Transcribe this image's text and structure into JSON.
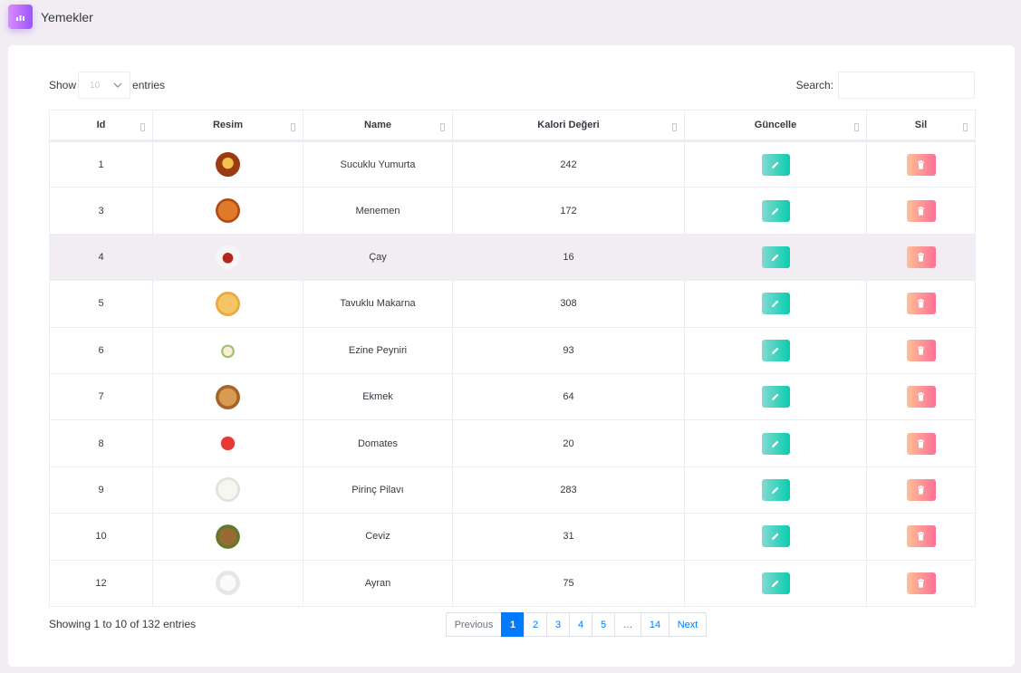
{
  "header": {
    "title": "Yemekler",
    "icon": "chart-icon"
  },
  "length": {
    "show_label": "Show",
    "value": "10",
    "entries_label": "entries"
  },
  "search": {
    "label": "Search:",
    "value": ""
  },
  "columns": [
    "Id",
    "Resim",
    "Name",
    "Kalori Değeri",
    "Güncelle",
    "Sil"
  ],
  "rows": [
    {
      "id": "1",
      "name": "Sucuklu Yumurta",
      "kalori": "242",
      "image": "sucuklu-yumurta-thumbnail"
    },
    {
      "id": "3",
      "name": "Menemen",
      "kalori": "172",
      "image": "menemen-thumbnail"
    },
    {
      "id": "4",
      "name": "Çay",
      "kalori": "16",
      "image": "cay-thumbnail"
    },
    {
      "id": "5",
      "name": "Tavuklu Makarna",
      "kalori": "308",
      "image": "tavuklu-makarna-thumbnail"
    },
    {
      "id": "6",
      "name": "Ezine Peyniri",
      "kalori": "93",
      "image": "ezine-peyniri-thumbnail"
    },
    {
      "id": "7",
      "name": "Ekmek",
      "kalori": "64",
      "image": "ekmek-thumbnail"
    },
    {
      "id": "8",
      "name": "Domates",
      "kalori": "20",
      "image": "domates-thumbnail"
    },
    {
      "id": "9",
      "name": "Pirinç Pilavı",
      "kalori": "283",
      "image": "pirinc-pilavi-thumbnail"
    },
    {
      "id": "10",
      "name": "Ceviz",
      "kalori": "31",
      "image": "ceviz-thumbnail"
    },
    {
      "id": "12",
      "name": "Ayran",
      "kalori": "75",
      "image": "ayran-thumbnail"
    }
  ],
  "info": "Showing 1 to 10 of 132 entries",
  "pagination": {
    "previous": "Previous",
    "pages": [
      "1",
      "2",
      "3",
      "4",
      "5"
    ],
    "ellipsis": "…",
    "last": "14",
    "next": "Next",
    "active": "1"
  },
  "colors": {
    "edit_button": "#07cdae",
    "delete_button": "#fe7096",
    "header_icon": "#9a55ff",
    "active_page": "#007bff",
    "highlight_row": "#f2edf3"
  }
}
